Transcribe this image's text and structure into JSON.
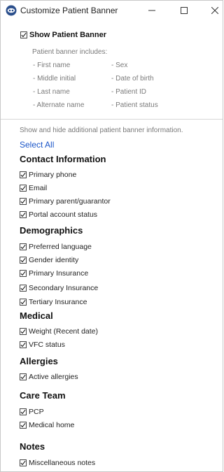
{
  "window": {
    "title": "Customize Patient Banner",
    "app_icon": "app-logo-icon",
    "controls": {
      "minimize": "minimize-icon",
      "maximize": "maximize-icon",
      "close": "close-icon"
    }
  },
  "banner": {
    "show_label": "Show Patient Banner",
    "show_checked": true,
    "includes_label": "Patient banner includes:",
    "items_left": [
      "- First name",
      "- Middle initial",
      "- Last name",
      "- Alternate name"
    ],
    "items_right": [
      "- Sex",
      "- Date of birth",
      "- Patient ID",
      "- Patient status"
    ]
  },
  "additional": {
    "hint": "Show and hide additional patient banner information.",
    "select_all": "Select All",
    "contact": {
      "heading": "Contact Information",
      "items": [
        "Primary phone",
        "Email",
        "Primary parent/guarantor",
        "Portal account status"
      ]
    },
    "demographics": {
      "heading": "Demographics",
      "items": [
        "Preferred language",
        "Gender identity",
        "Primary Insurance",
        "Secondary Insurance",
        "Tertiary Insurance"
      ]
    },
    "medical": {
      "heading": "Medical",
      "items": [
        "Weight (Recent date)",
        "VFC status"
      ]
    },
    "allergies": {
      "heading": "Allergies",
      "items": [
        "Active allergies"
      ]
    },
    "care_team": {
      "heading": "Care Team",
      "items": [
        "PCP",
        "Medical home"
      ]
    },
    "notes": {
      "heading": "Notes",
      "items": [
        "Miscellaneous notes"
      ]
    }
  },
  "colors": {
    "link": "#1a55c8",
    "muted": "#7a7a7a",
    "app_icon": "#2b4f8c"
  }
}
